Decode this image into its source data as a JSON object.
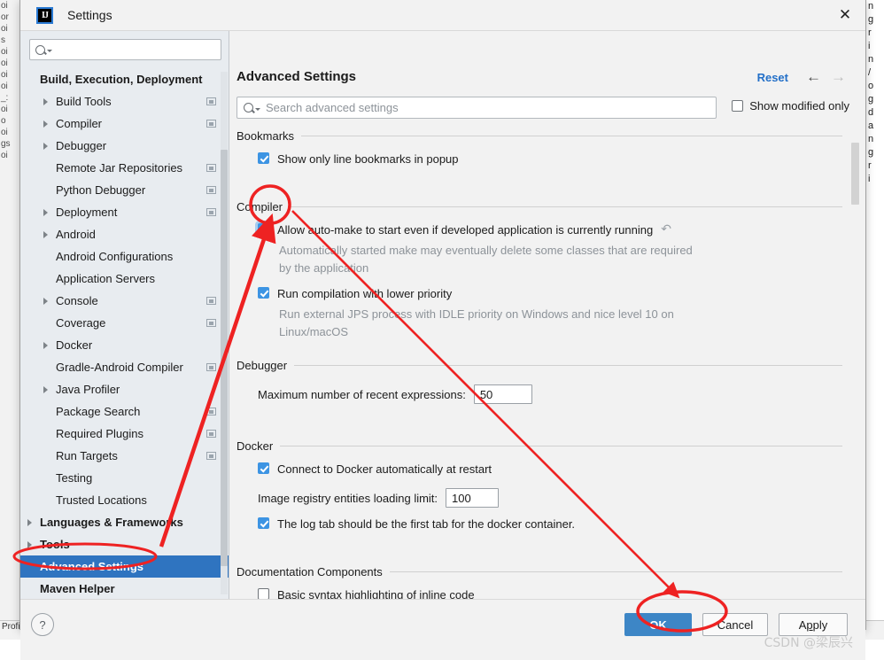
{
  "window": {
    "title": "Settings",
    "logo_text": "IJ",
    "close_label": "✕"
  },
  "sidebar": {
    "search_placeholder": "",
    "items": [
      {
        "label": "Build, Execution, Deployment",
        "level": 0,
        "arrow": false,
        "badge": false,
        "selected": false
      },
      {
        "label": "Build Tools",
        "level": 1,
        "arrow": true,
        "badge": true,
        "selected": false
      },
      {
        "label": "Compiler",
        "level": 1,
        "arrow": true,
        "badge": true,
        "selected": false
      },
      {
        "label": "Debugger",
        "level": 1,
        "arrow": true,
        "badge": false,
        "selected": false
      },
      {
        "label": "Remote Jar Repositories",
        "level": 1,
        "arrow": false,
        "badge": true,
        "selected": false
      },
      {
        "label": "Python Debugger",
        "level": 1,
        "arrow": false,
        "badge": true,
        "selected": false
      },
      {
        "label": "Deployment",
        "level": 1,
        "arrow": true,
        "badge": true,
        "selected": false
      },
      {
        "label": "Android",
        "level": 1,
        "arrow": true,
        "badge": false,
        "selected": false
      },
      {
        "label": "Android Configurations",
        "level": 1,
        "arrow": false,
        "badge": false,
        "selected": false
      },
      {
        "label": "Application Servers",
        "level": 1,
        "arrow": false,
        "badge": false,
        "selected": false
      },
      {
        "label": "Console",
        "level": 1,
        "arrow": true,
        "badge": true,
        "selected": false
      },
      {
        "label": "Coverage",
        "level": 1,
        "arrow": false,
        "badge": true,
        "selected": false
      },
      {
        "label": "Docker",
        "level": 1,
        "arrow": true,
        "badge": false,
        "selected": false
      },
      {
        "label": "Gradle-Android Compiler",
        "level": 1,
        "arrow": false,
        "badge": true,
        "selected": false
      },
      {
        "label": "Java Profiler",
        "level": 1,
        "arrow": true,
        "badge": false,
        "selected": false
      },
      {
        "label": "Package Search",
        "level": 1,
        "arrow": false,
        "badge": true,
        "selected": false
      },
      {
        "label": "Required Plugins",
        "level": 1,
        "arrow": false,
        "badge": true,
        "selected": false
      },
      {
        "label": "Run Targets",
        "level": 1,
        "arrow": false,
        "badge": true,
        "selected": false
      },
      {
        "label": "Testing",
        "level": 1,
        "arrow": false,
        "badge": false,
        "selected": false
      },
      {
        "label": "Trusted Locations",
        "level": 1,
        "arrow": false,
        "badge": false,
        "selected": false
      },
      {
        "label": "Languages & Frameworks",
        "level": 0,
        "arrow": true,
        "badge": false,
        "selected": false
      },
      {
        "label": "Tools",
        "level": 0,
        "arrow": true,
        "badge": false,
        "selected": false
      },
      {
        "label": "Advanced Settings",
        "level": 0,
        "arrow": false,
        "badge": false,
        "selected": true
      },
      {
        "label": "Maven Helper",
        "level": 0,
        "arrow": false,
        "badge": false,
        "selected": false
      }
    ]
  },
  "content": {
    "title": "Advanced Settings",
    "reset_label": "Reset",
    "nav_back": "←",
    "nav_forward": "→",
    "search_placeholder": "Search advanced settings",
    "show_modified_only": {
      "label": "Show modified only",
      "checked": false
    },
    "sections": [
      {
        "name": "Bookmarks",
        "options": [
          {
            "label": "Show only line bookmarks in popup",
            "checked": true,
            "hint": "",
            "revert": false
          }
        ]
      },
      {
        "name": "Compiler",
        "options": [
          {
            "label": "Allow auto-make to start even if developed application is currently running",
            "checked": true,
            "hint": "Automatically started make may eventually delete some classes that are required by the application",
            "revert": true,
            "revert_icon": "revert-arrow-icon",
            "focused": true
          },
          {
            "label": "Run compilation with lower priority",
            "checked": true,
            "hint": "Run external JPS process with IDLE priority on Windows and nice level 10 on Linux/macOS",
            "revert": false
          }
        ]
      },
      {
        "name": "Debugger",
        "fields": [
          {
            "label": "Maximum number of recent expressions:",
            "value": "50",
            "width": 66
          }
        ]
      },
      {
        "name": "Docker",
        "options": [
          {
            "label": "Connect to Docker automatically at restart",
            "checked": true,
            "hint": "",
            "revert": false
          },
          {
            "label": "The log tab should be the first tab for the docker container.",
            "checked": true,
            "hint": "",
            "revert": false
          }
        ],
        "fields": [
          {
            "label": "Image registry entities loading limit:",
            "value": "100",
            "width": 60
          }
        ]
      },
      {
        "name": "Documentation Components",
        "options": [
          {
            "label": "Basic syntax highlighting of inline code",
            "checked": false,
            "hint": "",
            "revert": false
          }
        ]
      }
    ]
  },
  "footer": {
    "help_label": "?",
    "ok_label": "OK",
    "cancel_label": "Cancel",
    "apply_label_pre": "A",
    "apply_label_underline": "p",
    "apply_label_post": "ply",
    "watermark": "CSDN @梁辰兴"
  },
  "annotations": {
    "color": "#ee2222",
    "ellipse_checkbox": "red-ellipse-around-auto-make-checkbox",
    "ellipse_sidebar": "red-ellipse-around-advanced-settings",
    "ellipse_ok": "red-ellipse-around-ok-button",
    "arrow_to_checkbox": "red-arrow-pointing-to-auto-make-checkbox",
    "arrow_to_ok": "red-arrow-pointing-to-ok-button"
  },
  "background": {
    "left_lines": [
      "oi",
      "oi",
      "_:",
      "or",
      "o",
      "s",
      "gs"
    ],
    "right_lines": [
      "d",
      "/",
      "r",
      "a",
      "o",
      "i",
      "n",
      "g",
      "n",
      "g"
    ],
    "bottom_text": "Profiler"
  }
}
